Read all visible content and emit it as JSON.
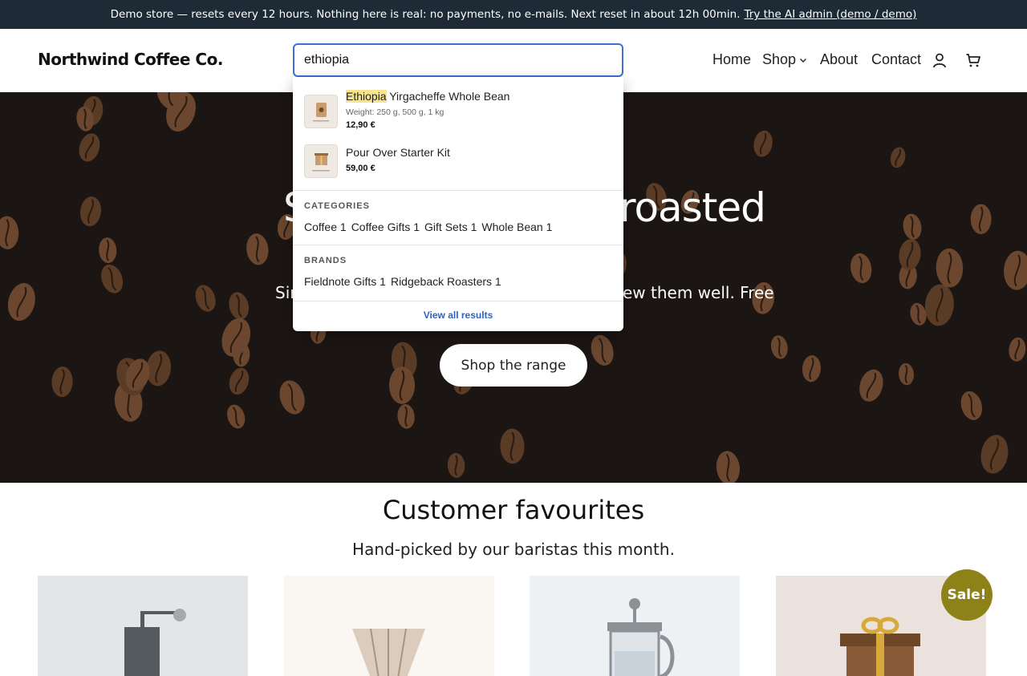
{
  "banner": {
    "text": "Demo store — resets every 12 hours. Nothing here is real: no payments, no e-mails. Next reset in about 12h 00min.",
    "link": "Try the AI admin (demo / demo)"
  },
  "header": {
    "logo": "Northwind Coffee Co.",
    "search_value": "ethiopia",
    "nav": {
      "home": "Home",
      "shop": "Shop",
      "about": "About",
      "contact": "Contact"
    }
  },
  "search_results": {
    "products": [
      {
        "name_highlight": "Ethiopia",
        "name_rest": " Yirgacheffe Whole Bean",
        "meta": "Weight: 250 g, 500 g, 1 kg",
        "price": "12,90 €",
        "thumb_icon": "coffee-bag-icon"
      },
      {
        "name": "Pour Over Starter Kit",
        "price": "59,00 €",
        "thumb_icon": "gift-box-icon"
      }
    ],
    "categories_heading": "CATEGORIES",
    "categories": [
      {
        "label": "Coffee",
        "count": "1"
      },
      {
        "label": "Coffee Gifts",
        "count": "1"
      },
      {
        "label": "Gift Sets",
        "count": "1"
      },
      {
        "label": "Whole Bean",
        "count": "1"
      }
    ],
    "brands_heading": "BRANDS",
    "brands": [
      {
        "label": "Fieldnote Gifts",
        "count": "1"
      },
      {
        "label": "Ridgeback Roasters",
        "count": "1"
      }
    ],
    "view_all": "View all results"
  },
  "hero": {
    "title_left": "S",
    "title_right": "roasted",
    "sub_left": "Sin",
    "sub_right": "ew them well. Free",
    "cta": "Shop the range",
    "bg_color": "#1b1513"
  },
  "favourites": {
    "title": "Customer favourites",
    "subtitle": "Hand-picked by our baristas this month.",
    "sale_badge": "Sale!",
    "cards": [
      {
        "icon": "coffee-grinder-icon",
        "bg": "#e3e6e8"
      },
      {
        "icon": "pour-over-dripper-icon",
        "bg": "#faf6f2"
      },
      {
        "icon": "french-press-icon",
        "bg": "#eef1f4"
      },
      {
        "icon": "gift-box-icon",
        "bg": "#ebe2dd"
      }
    ]
  },
  "colors": {
    "accent": "#3b6fd3",
    "link": "#2c63c4",
    "sale": "#8c8217",
    "banner": "#1e2a36"
  }
}
